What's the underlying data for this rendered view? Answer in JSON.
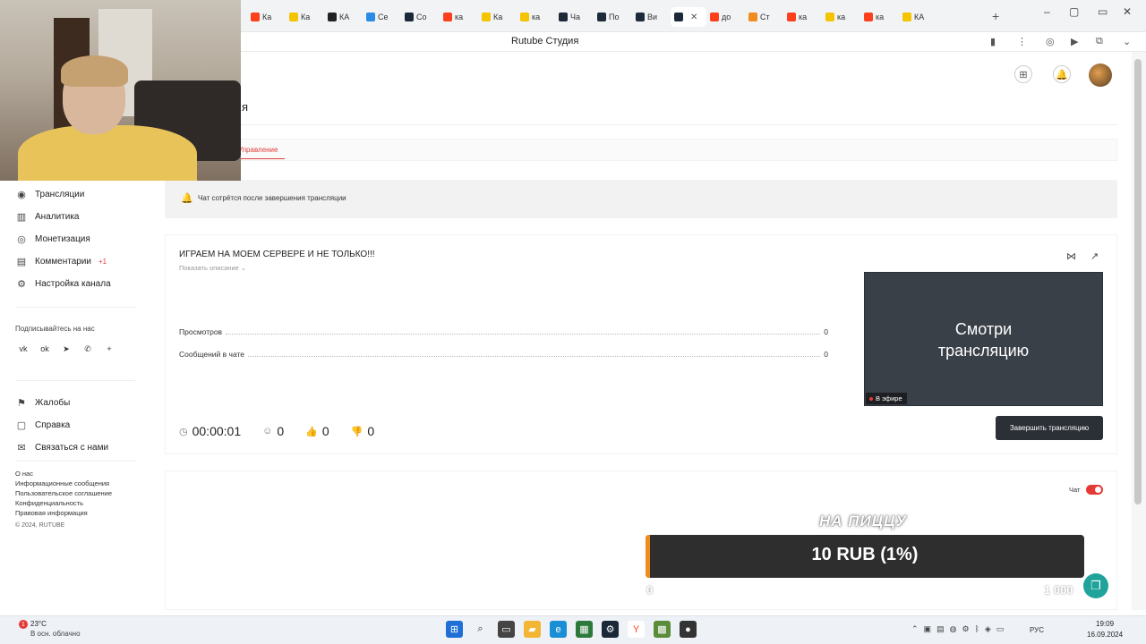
{
  "browser": {
    "tabs": [
      {
        "label": "Ка",
        "icon": "yandex-icon",
        "color": "#fc3f1d"
      },
      {
        "label": "Ка",
        "icon": "play-icon",
        "color": "#f5c400"
      },
      {
        "label": "КА",
        "icon": "plus-icon",
        "color": "#222222"
      },
      {
        "label": "Се",
        "icon": "grid-icon",
        "color": "#2a8be8"
      },
      {
        "label": "Со",
        "icon": "steam-icon",
        "color": "#1b2838"
      },
      {
        "label": "ка",
        "icon": "yandex-icon",
        "color": "#fc3f1d"
      },
      {
        "label": "Ка",
        "icon": "play-icon",
        "color": "#f5c400"
      },
      {
        "label": "ка",
        "icon": "play-icon",
        "color": "#f5c400"
      },
      {
        "label": "Ча",
        "icon": "rutube-icon",
        "color": "#1c2a3a"
      },
      {
        "label": "По",
        "icon": "rutube-icon",
        "color": "#1c2a3a"
      },
      {
        "label": "Ви",
        "icon": "rutube-icon",
        "color": "#1c2a3a"
      },
      {
        "label": "",
        "icon": "rutube-icon",
        "color": "#1c2a3a",
        "active": true
      },
      {
        "label": "до",
        "icon": "yandex-icon",
        "color": "#fc3f1d"
      },
      {
        "label": "Ст",
        "icon": "donation-icon",
        "color": "#f08c1e"
      },
      {
        "label": "ка",
        "icon": "yandex-icon",
        "color": "#fc3f1d"
      },
      {
        "label": "ка",
        "icon": "game-icon",
        "color": "#f5c400"
      },
      {
        "label": "ка",
        "icon": "yandex-icon",
        "color": "#fc3f1d"
      },
      {
        "label": "КА",
        "icon": "play-icon",
        "color": "#f5c400"
      }
    ],
    "page_title": "Rutube Студия"
  },
  "header": {
    "title_fragment": "я"
  },
  "subnav": {
    "active_tab": "Управление"
  },
  "sidebar": {
    "items": [
      {
        "label": "Трансляции",
        "icon": "broadcast-icon",
        "glyph": "◉"
      },
      {
        "label": "Аналитика",
        "icon": "analytics-icon",
        "glyph": "▥"
      },
      {
        "label": "Монетизация",
        "icon": "monetization-icon",
        "glyph": "◎"
      },
      {
        "label": "Комментарии",
        "icon": "comments-icon",
        "glyph": "▤",
        "count": "+1"
      },
      {
        "label": "Настройка канала",
        "icon": "settings-icon",
        "glyph": "⚙"
      }
    ],
    "follow_label": "Подписывайтесь на нас",
    "socials": [
      {
        "name": "vk-icon",
        "glyph": "vk"
      },
      {
        "name": "odnoklassniki-icon",
        "glyph": "ok"
      },
      {
        "name": "telegram-icon",
        "glyph": "➤"
      },
      {
        "name": "viber-icon",
        "glyph": "✆"
      },
      {
        "name": "more-icon",
        "glyph": "+"
      }
    ],
    "support": [
      {
        "label": "Жалобы",
        "icon": "flag-icon",
        "glyph": "⚑"
      },
      {
        "label": "Справка",
        "icon": "help-icon",
        "glyph": "▢"
      },
      {
        "label": "Связаться с нами",
        "icon": "contact-icon",
        "glyph": "✉"
      }
    ],
    "footer_links": [
      "О нас",
      "Информационные сообщения",
      "Пользовательское соглашение",
      "Конфиденциальность",
      "Правовая информация"
    ],
    "copyright": "© 2024, RUTUBE"
  },
  "notice": {
    "text": "Чат сотрётся после завершения трансляции"
  },
  "stream": {
    "title": "ИГРАЕМ НА МОЕМ СЕРВЕРЕ И НЕ ТОЛЬКО!!!",
    "show_description": "Показать описание",
    "stats": [
      {
        "label": "Просмотров",
        "value": "0"
      },
      {
        "label": "Сообщений в чате",
        "value": "0"
      }
    ],
    "preview_text_line1": "Смотри",
    "preview_text_line2": "трансляцию",
    "live_label": "В эфире",
    "duration": "00:00:01",
    "viewers": "0",
    "likes": "0",
    "dislikes": "0",
    "end_button": "Завершить трансляцию"
  },
  "chat": {
    "label": "Чат",
    "enabled": true
  },
  "donation": {
    "goal_title": "НА ПИЦЦУ",
    "value_text": "10 RUB (1%)",
    "progress_percent": 1,
    "min_label": "0",
    "max_label": "1 000"
  },
  "taskbar": {
    "weather_badge": "1",
    "temperature": "23°C",
    "weather_desc": "В осн. облачно",
    "lang": "РУС",
    "time": "19:09",
    "date": "16.09.2024"
  }
}
